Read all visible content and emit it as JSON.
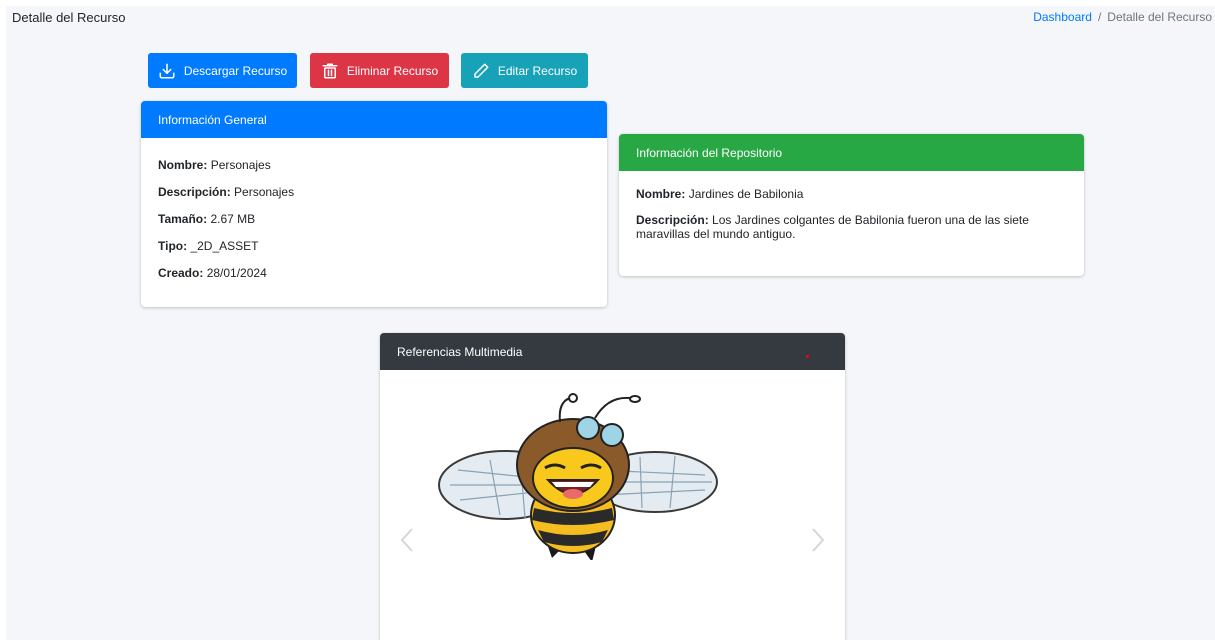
{
  "header": {
    "page_title": "Detalle del Recurso",
    "breadcrumb": {
      "link": "Dashboard",
      "separator": "/",
      "current": "Detalle del Recurso"
    }
  },
  "actions": {
    "download": {
      "label": "Descargar Recurso",
      "icon": "download-icon",
      "color": "#007bff"
    },
    "delete": {
      "label": "Eliminar Recurso",
      "icon": "trash-icon",
      "color": "#dc3545"
    },
    "edit": {
      "label": "Editar Recurso",
      "icon": "pencil-icon",
      "color": "#17a2b8"
    }
  },
  "general_info": {
    "title": "Información General",
    "color": "#007bff",
    "fields": [
      {
        "label": "Nombre:",
        "value": "Personajes"
      },
      {
        "label": "Descripción:",
        "value": "Personajes"
      },
      {
        "label": "Tamaño:",
        "value": "2.67 MB"
      },
      {
        "label": "Tipo:",
        "value": "_2D_ASSET"
      },
      {
        "label": "Creado:",
        "value": "28/01/2024"
      }
    ]
  },
  "repository_info": {
    "title": "Información del Repositorio",
    "color": "#28a745",
    "fields": [
      {
        "label": "Nombre:",
        "value": "Jardines de Babilonia"
      },
      {
        "label": "Descripción:",
        "value": "Los Jardines colgantes de Babilonia fueron una de las siete maravillas del mundo antiguo."
      }
    ]
  },
  "media": {
    "title": "Referencias Multimedia",
    "color": "#343a40",
    "image": "bee-aviator-cartoon",
    "prev_icon": "chevron-left-icon",
    "next_icon": "chevron-right-icon"
  }
}
